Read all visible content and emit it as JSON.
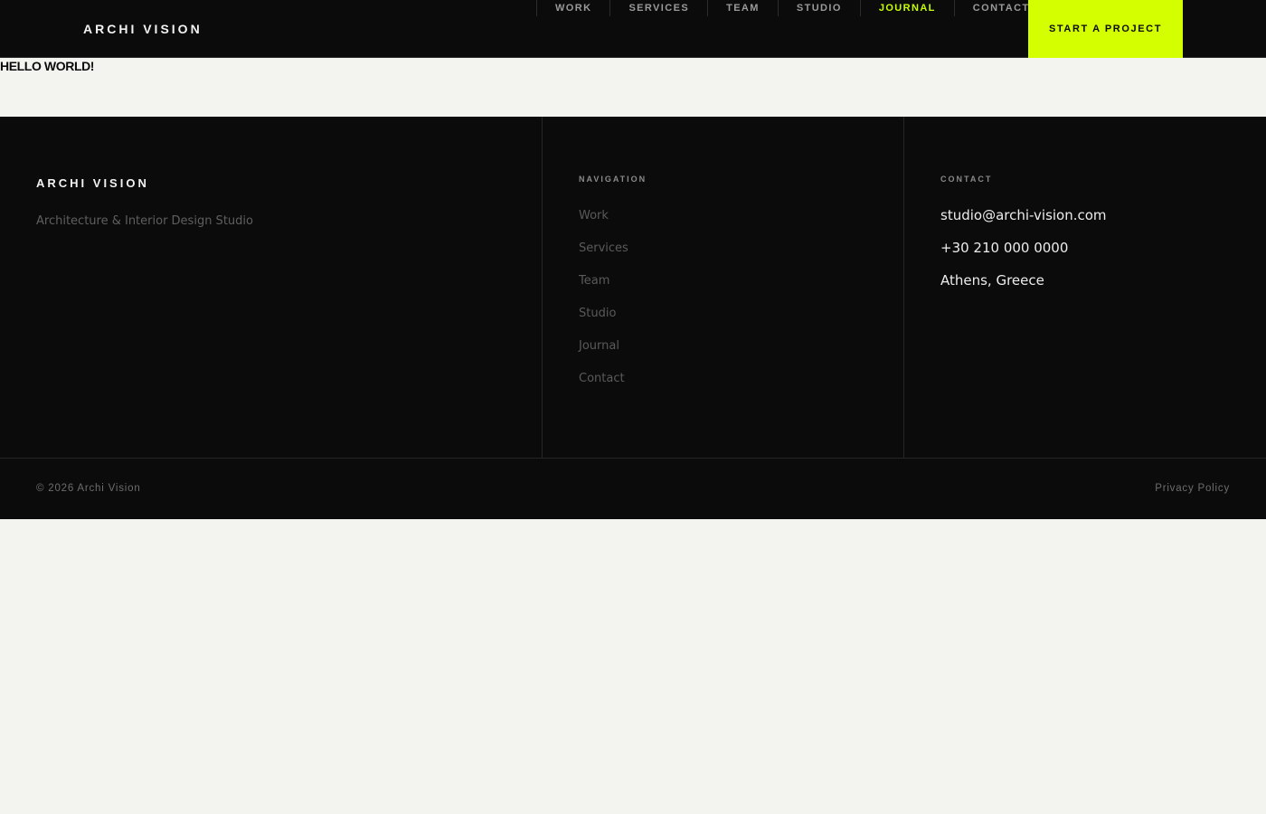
{
  "header": {
    "brand": "ARCHI VISION",
    "nav": [
      {
        "label": "WORK",
        "active": false
      },
      {
        "label": "SERVICES",
        "active": false
      },
      {
        "label": "TEAM",
        "active": false
      },
      {
        "label": "STUDIO",
        "active": false
      },
      {
        "label": "JOURNAL",
        "active": true
      },
      {
        "label": "CONTACT",
        "active": false
      }
    ],
    "cta_label": "START A PROJECT"
  },
  "main": {
    "heading": "HELLO WORLD!"
  },
  "footer": {
    "brand": "ARCHI VISION",
    "tagline": "Architecture & Interior Design Studio",
    "navigation": {
      "heading": "NAVIGATION",
      "items": [
        "Work",
        "Services",
        "Team",
        "Studio",
        "Journal",
        "Contact"
      ]
    },
    "contact": {
      "heading": "CONTACT",
      "email": "studio@archi-vision.com",
      "phone": "+30 210 000 0000",
      "location": "Athens, Greece"
    },
    "copyright": "© 2026 Archi Vision",
    "privacy_label": "Privacy Policy"
  },
  "colors": {
    "background": "#f3f4ef",
    "dark": "#0b0b0b",
    "accent": "#d4ff00",
    "active_nav": "#c6ff00"
  }
}
